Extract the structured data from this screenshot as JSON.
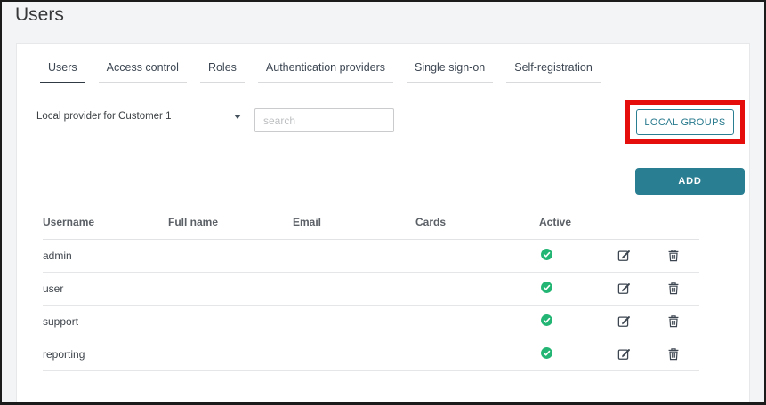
{
  "window": {
    "title": "Users"
  },
  "tabs": [
    {
      "label": "Users",
      "active": true
    },
    {
      "label": "Access control",
      "active": false
    },
    {
      "label": "Roles",
      "active": false
    },
    {
      "label": "Authentication providers",
      "active": false
    },
    {
      "label": "Single sign-on",
      "active": false
    },
    {
      "label": "Self-registration",
      "active": false
    }
  ],
  "filters": {
    "provider_select": {
      "value": "Local provider for Customer 1",
      "icon": "chevron-down-icon"
    },
    "search": {
      "placeholder": "search",
      "value": ""
    }
  },
  "buttons": {
    "local_groups": "LOCAL GROUPS",
    "add": "ADD"
  },
  "annotation": {
    "type": "highlight-box",
    "target": "local-groups-button",
    "color": "#e60d0d"
  },
  "table": {
    "columns": [
      "Username",
      "Full name",
      "Email",
      "Cards",
      "Active"
    ],
    "row_action_icons": [
      "edit-icon",
      "trash-icon"
    ],
    "rows": [
      {
        "username": "admin",
        "full_name": "",
        "email": "",
        "cards": "",
        "active": true
      },
      {
        "username": "user",
        "full_name": "",
        "email": "",
        "cards": "",
        "active": true
      },
      {
        "username": "support",
        "full_name": "",
        "email": "",
        "cards": "",
        "active": true
      },
      {
        "username": "reporting",
        "full_name": "",
        "email": "",
        "cards": "",
        "active": true
      }
    ]
  },
  "colors": {
    "accent_teal": "#2a7e92",
    "active_green": "#22b573",
    "annotation_red": "#e60d0d",
    "icon_slate": "#3d4650"
  }
}
